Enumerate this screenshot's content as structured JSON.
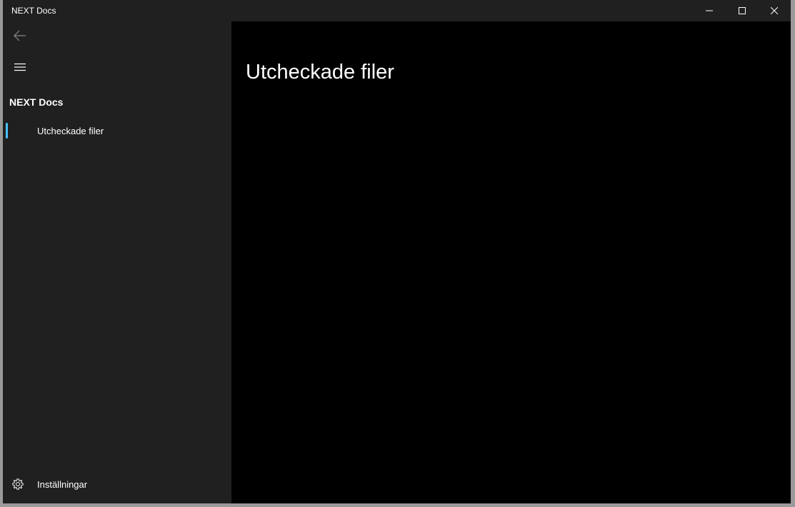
{
  "window": {
    "title": "NEXT Docs"
  },
  "nav": {
    "header": "NEXT Docs",
    "items": [
      {
        "label": "Utcheckade filer",
        "selected": true
      }
    ],
    "settings_label": "Inställningar"
  },
  "content": {
    "title": "Utcheckade filer"
  },
  "colors": {
    "accent": "#4cc2ff",
    "pane_bg": "#202020",
    "content_bg": "#000000",
    "text": "#ffffff"
  },
  "icons": {
    "back": "back-arrow-icon",
    "menu": "hamburger-menu-icon",
    "settings": "gear-icon",
    "minimize": "minimize-icon",
    "maximize": "maximize-icon",
    "close": "close-icon"
  }
}
